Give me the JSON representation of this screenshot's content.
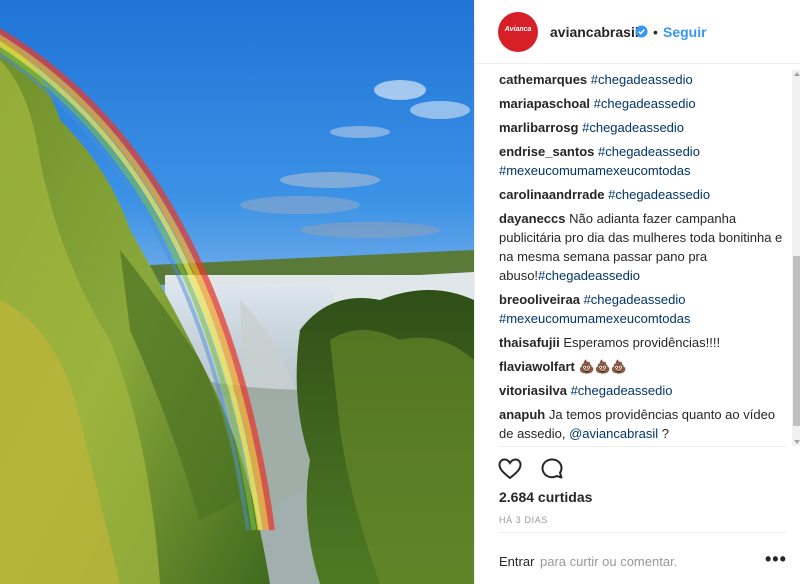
{
  "header": {
    "avatar_text": "Avianca",
    "username": "aviancabrasil",
    "dot": "•",
    "follow_label": "Seguir"
  },
  "comments": [
    {
      "user": "cathemarques",
      "parts": [
        {
          "t": "tag",
          "v": "#chegadeassedio"
        }
      ]
    },
    {
      "user": "mariapaschoal",
      "parts": [
        {
          "t": "tag",
          "v": "#chegadeassedio"
        }
      ]
    },
    {
      "user": "marlibarrosg",
      "parts": [
        {
          "t": "tag",
          "v": "#chegadeassedio"
        }
      ]
    },
    {
      "user": "endrise_santos",
      "parts": [
        {
          "t": "tag",
          "v": "#chegadeassedio"
        },
        {
          "t": "text",
          "v": " "
        },
        {
          "t": "tag",
          "v": "#mexeucomumamexeucomtodas"
        }
      ]
    },
    {
      "user": "carolinaandrrade",
      "parts": [
        {
          "t": "tag",
          "v": "#chegadeassedio"
        }
      ]
    },
    {
      "user": "dayaneccs",
      "parts": [
        {
          "t": "text",
          "v": "Não adianta fazer campanha publicitária pro dia das mulheres toda bonitinha e na mesma semana passar pano pra abuso!"
        },
        {
          "t": "tag",
          "v": "#chegadeassedio"
        }
      ]
    },
    {
      "user": "breooliveiraa",
      "parts": [
        {
          "t": "tag",
          "v": "#chegadeassedio"
        },
        {
          "t": "text",
          "v": " "
        },
        {
          "t": "tag",
          "v": "#mexeucomumamexeucomtodas"
        }
      ]
    },
    {
      "user": "thaisafujii",
      "parts": [
        {
          "t": "text",
          "v": "Esperamos providências!!!!"
        }
      ]
    },
    {
      "user": "flaviawolfart",
      "parts": [
        {
          "t": "text",
          "v": "💩💩💩"
        }
      ]
    },
    {
      "user": "vitoriasilva",
      "parts": [
        {
          "t": "tag",
          "v": "#chegadeassedio"
        }
      ]
    },
    {
      "user": "anapuh",
      "parts": [
        {
          "t": "text",
          "v": "Ja temos providências quanto ao vídeo de assedio, "
        },
        {
          "t": "mention",
          "v": "@aviancabrasil"
        },
        {
          "t": "text",
          "v": " ?"
        }
      ]
    }
  ],
  "actions": {
    "like_icon": "heart-icon",
    "comment_icon": "comment-bubble-icon"
  },
  "likes": "2.684 curtidas",
  "timestamp": "HÁ 3 DIAS",
  "add_comment": {
    "login_label": "Entrar",
    "prompt": "para curtir ou comentar.",
    "more_label": "•••"
  },
  "colors": {
    "link": "#3897f0",
    "hashtag": "#003569",
    "brand": "#d61f26"
  }
}
